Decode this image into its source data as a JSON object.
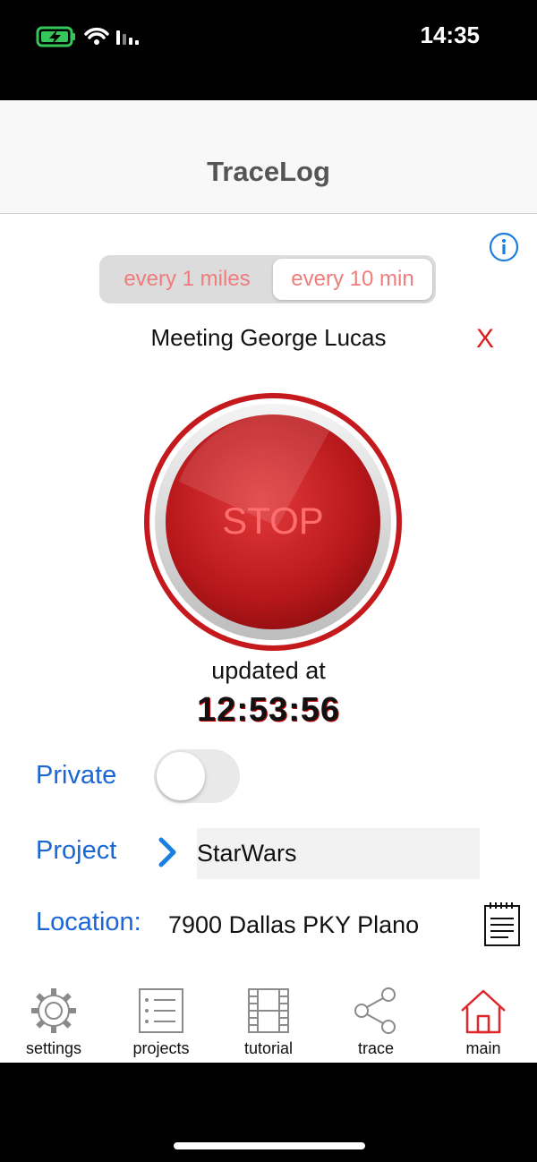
{
  "status_bar": {
    "time": "14:35"
  },
  "app": {
    "title": "TraceLog"
  },
  "interval": {
    "options": [
      "every 1 miles",
      "every 10 min"
    ],
    "selected": "every 10 min"
  },
  "trip_note": "Meeting George Lucas",
  "clear_label": "X",
  "stop_button": {
    "label": "STOP"
  },
  "updated": {
    "label": "updated at",
    "time": "12:53:56"
  },
  "private": {
    "label": "Private",
    "on": false
  },
  "project": {
    "label": "Project",
    "value": "StarWars"
  },
  "location": {
    "label": "Location:",
    "value": "7900 Dallas PKY Plano"
  },
  "tabs": [
    {
      "label": "settings",
      "icon": "gear-icon"
    },
    {
      "label": "projects",
      "icon": "list-icon"
    },
    {
      "label": "tutorial",
      "icon": "film-icon"
    },
    {
      "label": "trace",
      "icon": "share-icon"
    },
    {
      "label": "main",
      "icon": "home-icon",
      "active": true
    }
  ],
  "colors": {
    "accent_blue": "#1a66d6",
    "stop_red": "#c8191c",
    "active_tab": "#e0262b"
  }
}
